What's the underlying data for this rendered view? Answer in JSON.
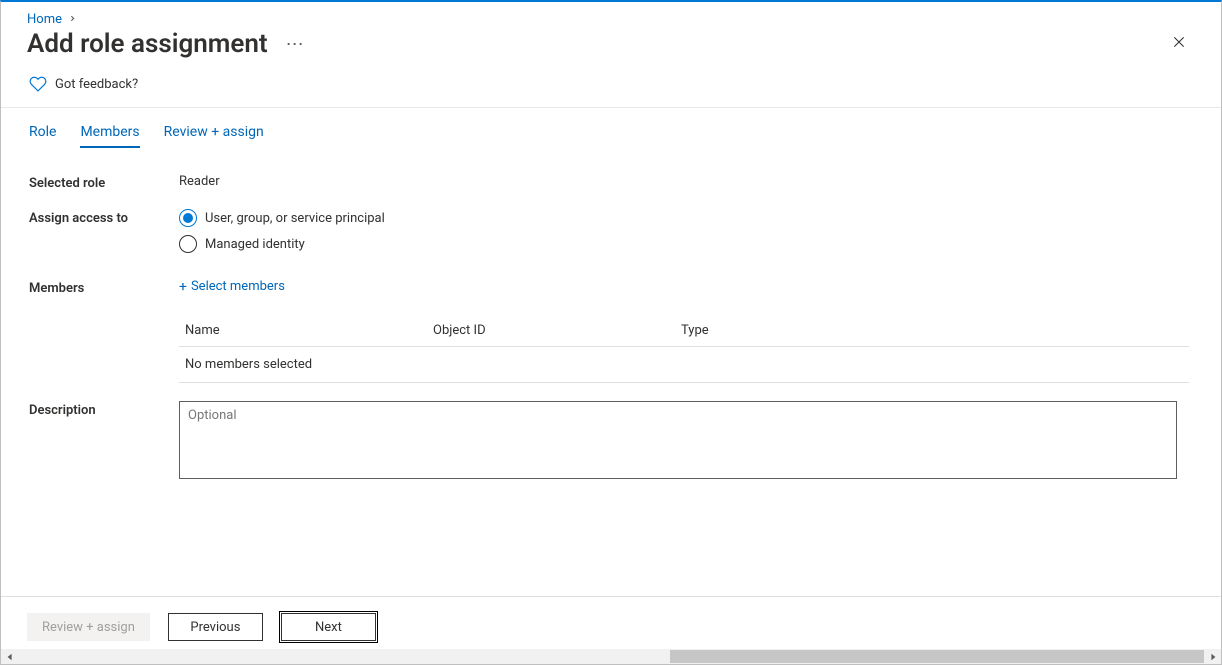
{
  "breadcrumb": {
    "home": "Home"
  },
  "page_title": "Add role assignment",
  "feedback": {
    "text": "Got feedback?"
  },
  "tabs": [
    {
      "label": "Role"
    },
    {
      "label": "Members"
    },
    {
      "label": "Review + assign"
    }
  ],
  "form": {
    "selected_role_label": "Selected role",
    "selected_role_value": "Reader",
    "assign_label": "Assign access to",
    "assign_option_usp": "User, group, or service principal",
    "assign_option_mi": "Managed identity",
    "members_label": "Members",
    "select_members_link": "Select members",
    "table": {
      "col_name": "Name",
      "col_oid": "Object ID",
      "col_type": "Type",
      "empty": "No members selected"
    },
    "description_label": "Description",
    "description_placeholder": "Optional"
  },
  "footer": {
    "review": "Review + assign",
    "previous": "Previous",
    "next": "Next"
  }
}
